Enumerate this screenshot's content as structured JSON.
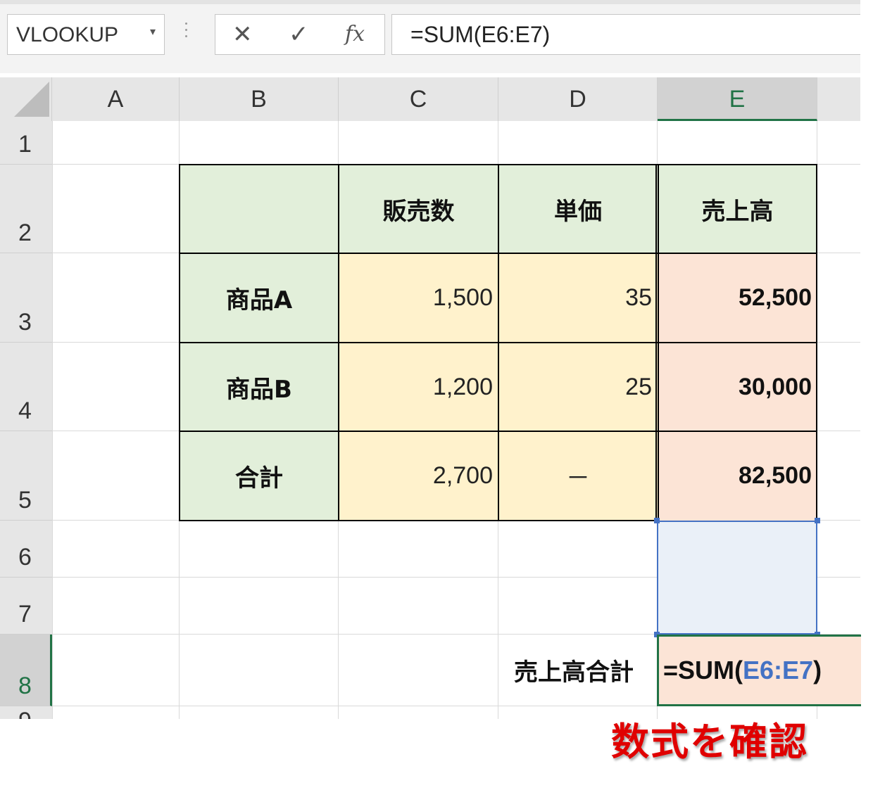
{
  "name_box": {
    "value": "VLOOKUP"
  },
  "formula_bar": {
    "cancel_icon": "✕",
    "enter_icon": "✓",
    "fx_icon": "fx",
    "formula": "=SUM(E6:E7)"
  },
  "columns": [
    "A",
    "B",
    "C",
    "D",
    "E"
  ],
  "rows": [
    "1",
    "2",
    "3",
    "4",
    "5",
    "6",
    "7",
    "8",
    "9"
  ],
  "table": {
    "headers": {
      "b": "",
      "c": "販売数",
      "d": "単価",
      "e": "売上高"
    },
    "rows": [
      {
        "label": "商品A",
        "qty": "1,500",
        "price": "35",
        "sales": "52,500"
      },
      {
        "label": "商品B",
        "qty": "1,200",
        "price": "25",
        "sales": "30,000"
      },
      {
        "label": "合計",
        "qty": "2,700",
        "price": "－",
        "sales": "82,500"
      }
    ]
  },
  "summary": {
    "label": "売上高合計",
    "formula_prefix": "=SUM(",
    "formula_ref": "E6:E7",
    "formula_suffix": ")"
  },
  "annotation": "数式を確認",
  "colors": {
    "header_fill": "#e2efda",
    "number_fill": "#fff2cc",
    "sales_fill": "#fce4d6",
    "range_border": "#4472c4",
    "active_border": "#217346",
    "annotation": "#e00000"
  }
}
